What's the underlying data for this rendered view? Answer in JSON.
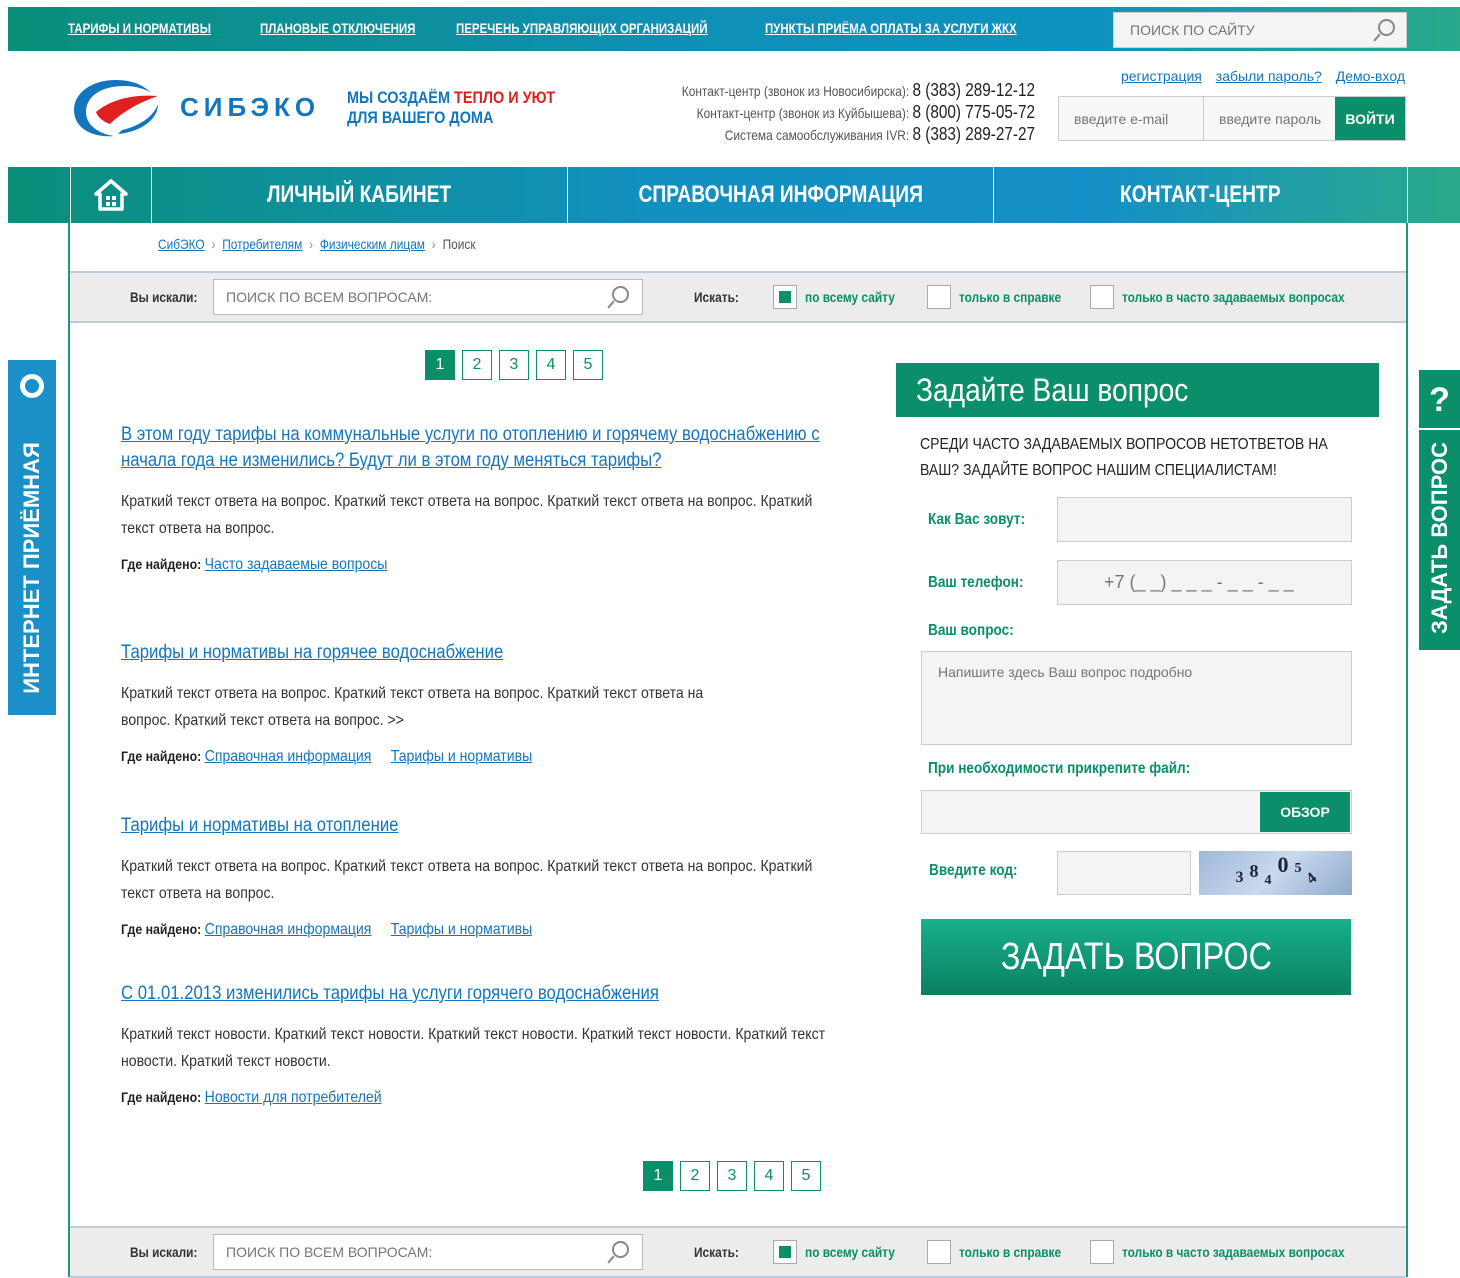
{
  "top_links": [
    "ТАРИФЫ И НОРМАТИВЫ",
    "ПЛАНОВЫЕ ОТКЛЮЧЕНИЯ",
    "ПЕРЕЧЕНЬ УПРАВЛЯЮЩИХ ОРГАНИЗАЦИЙ",
    "ПУНКТЫ ПРИЁМА ОПЛАТЫ ЗА УСЛУГИ ЖКХ"
  ],
  "site_search": {
    "placeholder": "ПОИСК ПО САЙТУ"
  },
  "logo": {
    "text": "СИБЭКО"
  },
  "slogan": {
    "line1_a": "МЫ СОЗДАЁМ ",
    "line1_b": "ТЕПЛО И УЮТ",
    "line2": "ДЛЯ ВАШЕГО ДОМА"
  },
  "contacts": [
    {
      "label": "Контакт-центр (звонок из Новосибирска): ",
      "phone": "8 (383) 289-12-12"
    },
    {
      "label": "Контакт-центр (звонок из Куйбышева): ",
      "phone": "8 (800) 775-05-72"
    },
    {
      "label": "Система самообслуживания IVR: ",
      "phone": "8 (383) 289-27-27"
    }
  ],
  "auth": {
    "register": "регистрация",
    "forgot": "забыли пароль?",
    "demo": "Демо-вход",
    "email_placeholder": "введите e-mail",
    "password_placeholder": "введите пароль",
    "login": "ВОЙТИ"
  },
  "nav": [
    "ЛИЧНЫЙ КАБИНЕТ",
    "СПРАВОЧНАЯ ИНФОРМАЦИЯ",
    "КОНТАКТ-ЦЕНТР"
  ],
  "breadcrumb": {
    "items": [
      "СибЭКО",
      "Потребителям",
      "Физическим лицам"
    ],
    "current": "Поиск"
  },
  "searchbar": {
    "label": "Вы искали:",
    "placeholder": "ПОИСК ПО ВСЕМ ВОПРОСАМ:",
    "scope_label": "Искать:",
    "options": [
      {
        "label": "по всему сайту",
        "checked": true
      },
      {
        "label": "только в справке",
        "checked": false
      },
      {
        "label": "только в часто задаваемых вопросах",
        "checked": false
      }
    ]
  },
  "pager": {
    "pages": [
      "1",
      "2",
      "3",
      "4",
      "5"
    ],
    "active": 1
  },
  "where_label": "Где найдено:",
  "results": [
    {
      "title": "В этом году тарифы на коммунальные услуги по отоплению и горячему водоснабжению с начала года не изменились? Будут ли в этом году меняться тарифы?",
      "text": "Краткий текст ответа на вопрос. Краткий текст ответа на вопрос. Краткий текст ответа на вопрос. Краткий текст ответа на вопрос.",
      "where": [
        "Часто задаваемые вопросы"
      ]
    },
    {
      "title": "Тарифы и нормативы на горячее водоснабжение",
      "text": "Краткий текст ответа на вопрос. Краткий текст ответа на вопрос. Краткий текст ответа на вопрос. Краткий текст ответа на вопрос. >>",
      "where": [
        "Справочная информация",
        "Тарифы и нормативы"
      ]
    },
    {
      "title": "Тарифы и нормативы на отопление",
      "text": "Краткий текст ответа на вопрос. Краткий текст ответа на вопрос. Краткий текст ответа на вопрос. Краткий текст ответа на вопрос.",
      "where": [
        "Справочная информация",
        "Тарифы и нормативы"
      ]
    },
    {
      "title": "С 01.01.2013 изменились тарифы на услуги горячего водоснабжения",
      "text": "Краткий текст новости. Краткий текст новости. Краткий текст новости. Краткий текст новости. Краткий текст новости. Краткий текст новости.",
      "where": [
        "Новости для потребителей"
      ]
    }
  ],
  "ask": {
    "title": "Задайте Ваш вопрос",
    "intro": "СРЕДИ ЧАСТО ЗАДАВАЕМЫХ ВОПРОСОВ НЕТОТВЕТОВ НА ВАШ?  ЗАДАЙТЕ ВОПРОС НАШИМ СПЕЦИАЛИСТАМ!",
    "name_label": "Как Вас зовут:",
    "phone_label": "Ваш телефон:",
    "phone_placeholder": "+7 (_ _) _ _ _ - _ _ - _ _",
    "question_label": "Ваш вопрос:",
    "question_placeholder": "Напишите здесь Ваш вопрос подробно",
    "file_label": "При необходимости прикрепите файл:",
    "browse": "ОБЗОР",
    "code_label": "Введите код:",
    "captcha": [
      "3",
      "8",
      "4",
      "0",
      "5",
      "4"
    ],
    "submit": "ЗАДАТЬ ВОПРОС"
  },
  "side_left": "ИНТЕРНЕТ ПРИЁМНАЯ",
  "side_right": {
    "icon": "?",
    "text": "ЗАДАТЬ ВОПРОС"
  },
  "colors": {
    "green": "#0a8f6a",
    "blue": "#1475bf",
    "red": "#e02020"
  }
}
